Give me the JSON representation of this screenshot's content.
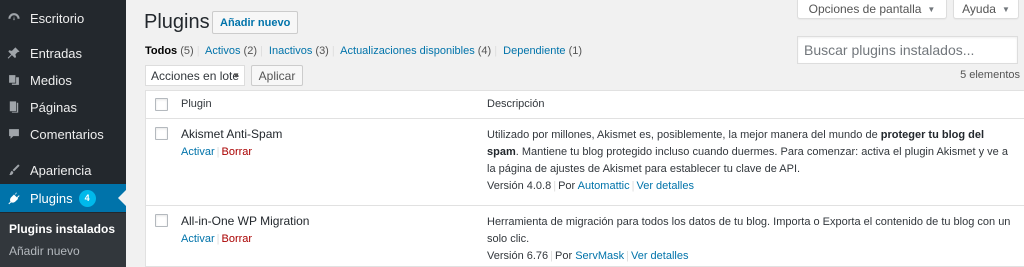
{
  "sidebar": {
    "items": [
      {
        "label": "Escritorio",
        "icon": "dashboard-icon"
      },
      {
        "label": "Entradas",
        "icon": "pushpin-icon"
      },
      {
        "label": "Medios",
        "icon": "media-icon"
      },
      {
        "label": "Páginas",
        "icon": "page-icon"
      },
      {
        "label": "Comentarios",
        "icon": "comment-icon"
      },
      {
        "label": "Apariencia",
        "icon": "paintbrush-icon"
      },
      {
        "label": "Plugins",
        "icon": "plugin-icon",
        "badge": "4"
      }
    ],
    "submenu": [
      "Plugins instalados",
      "Añadir nuevo"
    ]
  },
  "header": {
    "screen_options": "Opciones de pantalla",
    "help": "Ayuda",
    "title": "Plugins",
    "add_new": "Añadir nuevo"
  },
  "filters": [
    {
      "label": "Todos",
      "count": "(5)"
    },
    {
      "label": "Activos",
      "count": "(2)"
    },
    {
      "label": "Inactivos",
      "count": "(3)"
    },
    {
      "label": "Actualizaciones disponibles",
      "count": "(4)"
    },
    {
      "label": "Dependiente",
      "count": "(1)"
    }
  ],
  "search": {
    "placeholder": "Buscar plugins instalados..."
  },
  "bulk": {
    "selected": "Acciones en lote",
    "apply": "Aplicar",
    "items_count": "5 elementos"
  },
  "table": {
    "columns": [
      "Plugin",
      "Descripción"
    ],
    "rows": [
      {
        "name": "Akismet Anti-Spam",
        "activate": "Activar",
        "delete": "Borrar",
        "desc_before": "Utilizado por millones, Akismet es, posiblemente, la mejor manera del mundo de ",
        "desc_bold": "proteger tu blog del spam",
        "desc_after": ". Mantiene tu blog protegido incluso cuando duermes. Para comenzar: activa el plugin Akismet y ve a la página de ajustes de Akismet para establecer tu clave de API.",
        "version": "Versión 4.0.8",
        "by": "Por",
        "author": "Automattic",
        "details": "Ver detalles"
      },
      {
        "name": "All-in-One WP Migration",
        "activate": "Activar",
        "delete": "Borrar",
        "desc_before": "Herramienta de migración para todos los datos de tu blog. Importa o Exporta el contenido de tu blog con un solo clic.",
        "desc_bold": "",
        "desc_after": "",
        "version": "Versión 6.76",
        "by": "Por",
        "author": "ServMask",
        "details": "Ver detalles"
      }
    ]
  },
  "colors": {
    "sidebar_bg": "#23282d",
    "accent": "#0073aa",
    "delete": "#a00",
    "badge": "#00b9eb"
  }
}
